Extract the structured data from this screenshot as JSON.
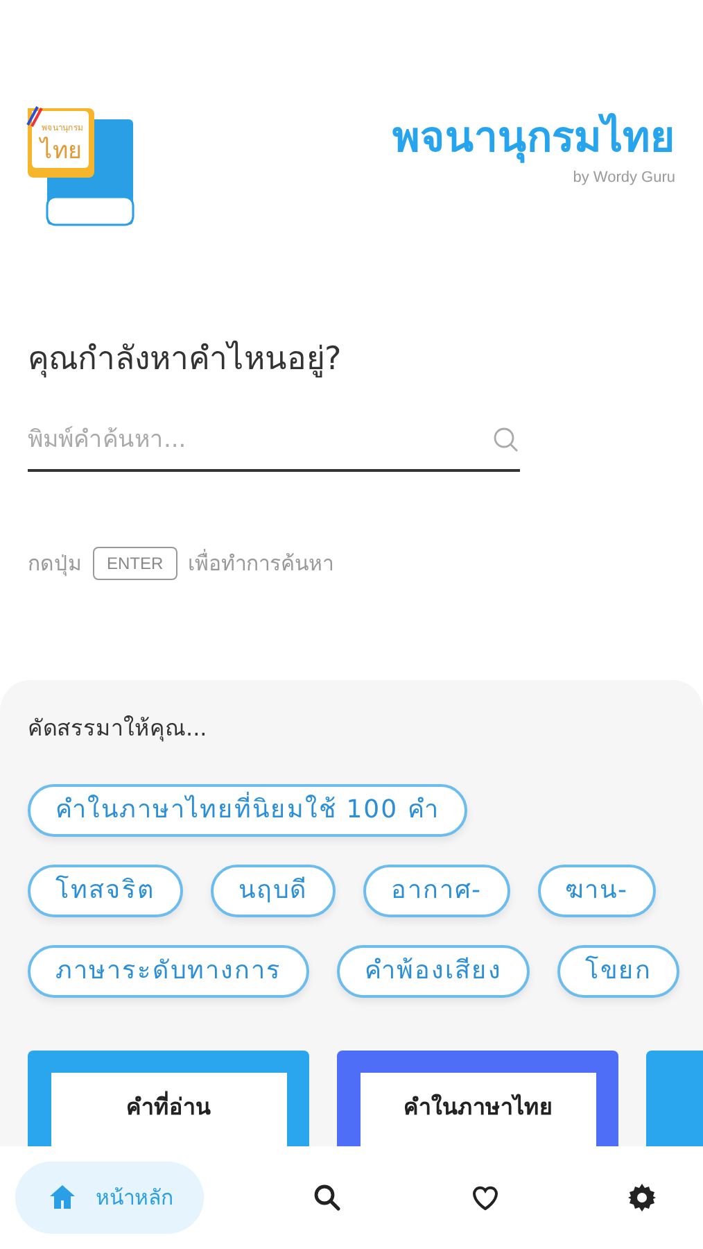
{
  "header": {
    "logo": {
      "small_text": "พจนานุกรม",
      "text": "ไทย"
    },
    "title": "พจนานุกรมไทย",
    "subtitle": "by Wordy Guru"
  },
  "search": {
    "question": "คุณกำลังหาคำไหนอยู่?",
    "placeholder": "พิมพ์คำค้นหา...",
    "hint_before": "กดปุ่ม",
    "key": "ENTER",
    "hint_after": "เพื่อทำการค้นหา"
  },
  "suggestions": {
    "title": "คัดสรรมาให้คุณ...",
    "chip_rows": [
      [
        "คำในภาษาไทยที่นิยมใช้ 100 คำ"
      ],
      [
        "โทสจริต",
        "นฤบดี",
        "อากาศ-",
        "ฆาน-"
      ],
      [
        "ภาษาระดับทางการ",
        "คำพ้องเสียง",
        "โขยก"
      ]
    ],
    "cards": [
      {
        "title": "คำที่อ่าน",
        "color": "#2aa6ef"
      },
      {
        "title": "คำในภาษาไทย",
        "color": "#4f6ef7"
      },
      {
        "color": "#2aa6ef"
      }
    ]
  },
  "nav": [
    {
      "kind": "home",
      "label": "หน้าหลัก",
      "selected": true
    },
    {
      "kind": "search",
      "selected": false
    },
    {
      "kind": "heart",
      "selected": false
    },
    {
      "kind": "gear",
      "selected": false
    }
  ]
}
